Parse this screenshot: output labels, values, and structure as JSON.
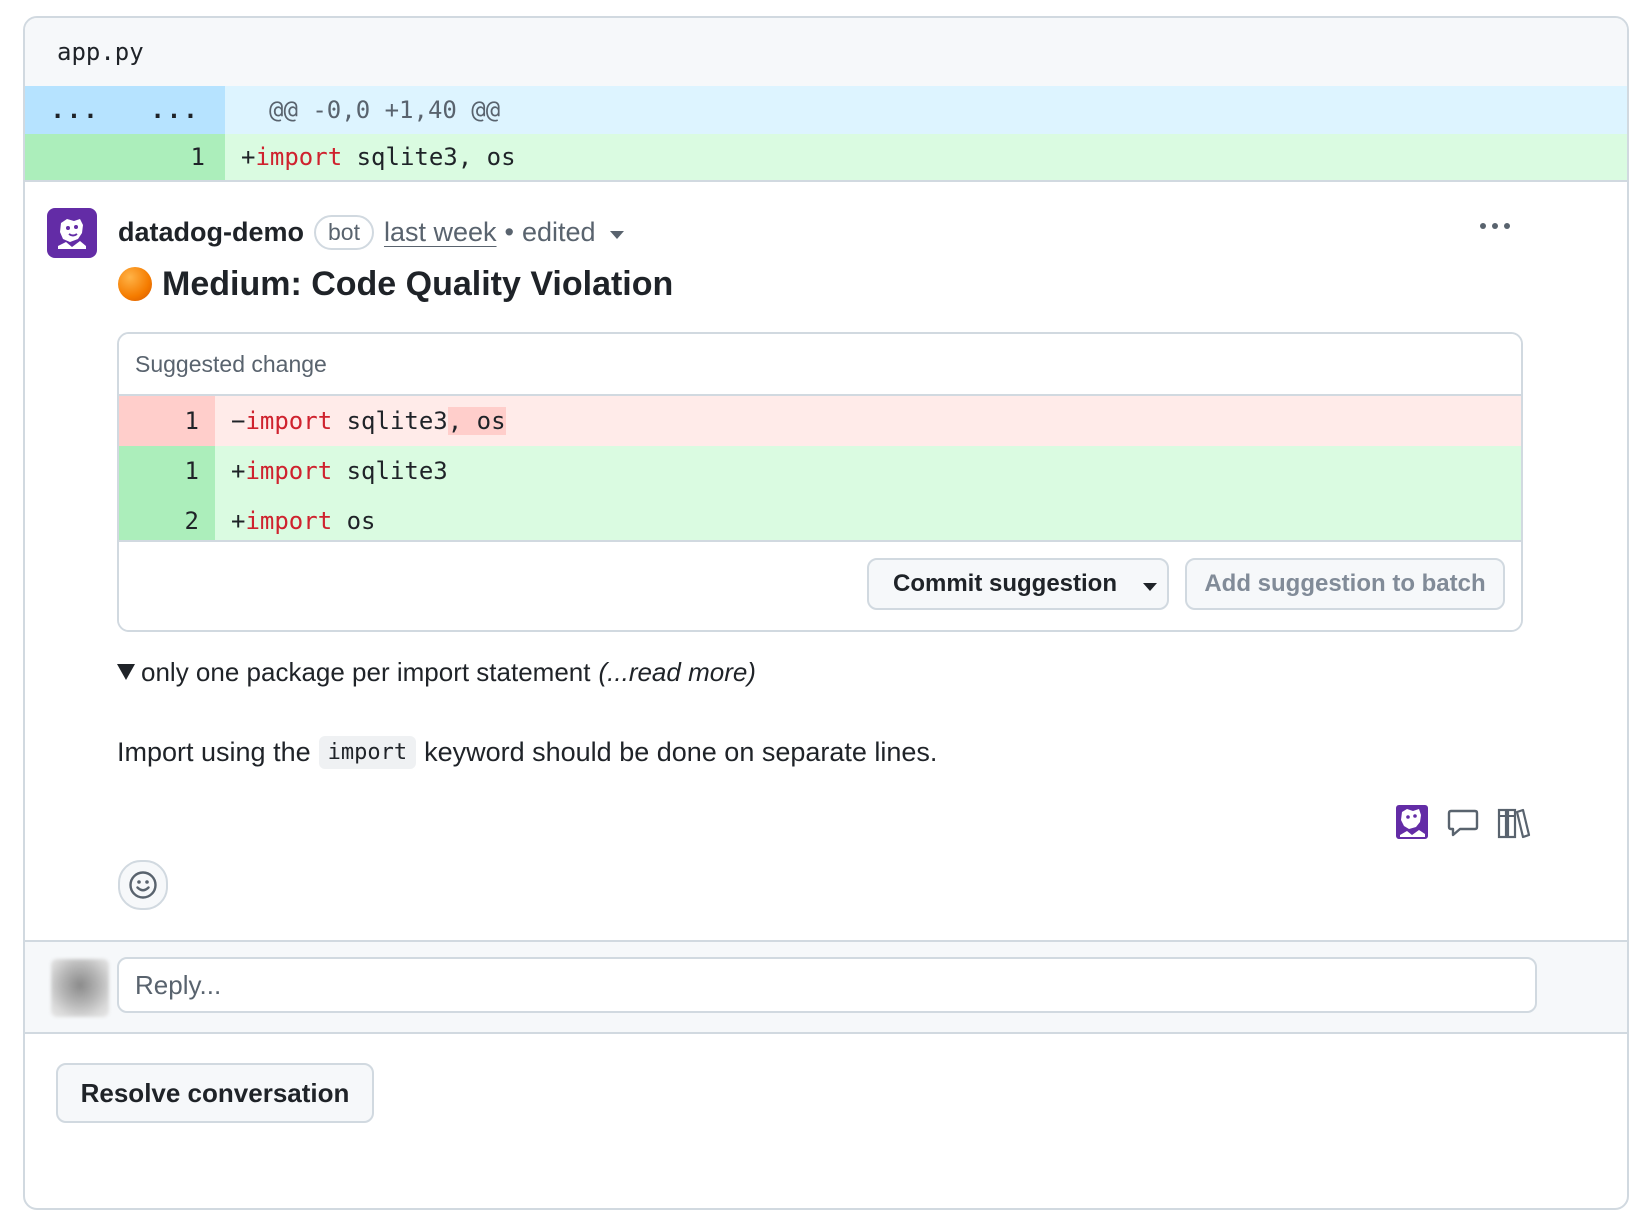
{
  "file": {
    "name": "app.py"
  },
  "hunk": {
    "old_marker": "...",
    "new_marker": "...",
    "header": "@@ -0,0 +1,40 @@"
  },
  "diff_line": {
    "number": "1",
    "sign": "+",
    "keyword": "import",
    "rest": " sqlite3, os"
  },
  "comment": {
    "author": "datadog-demo",
    "badge": "bot",
    "time": "last week",
    "separator": "•",
    "edited": "edited",
    "title": "Medium: Code Quality Violation",
    "severity_color": "#f57c00",
    "icons": [
      "datadog-logo-icon",
      "comment-icon",
      "library-icon",
      "smiley-icon",
      "kebab-menu-icon"
    ]
  },
  "suggestion": {
    "header": "Suggested change",
    "deleted": {
      "number": "1",
      "sign": "−",
      "keyword": "import",
      "kept": " sqlite3",
      "removed": ", os"
    },
    "added": [
      {
        "number": "1",
        "sign": "+",
        "keyword": "import",
        "rest": " sqlite3"
      },
      {
        "number": "2",
        "sign": "+",
        "keyword": "import",
        "rest": " os"
      }
    ],
    "commit_label": "Commit suggestion",
    "batch_label": "Add suggestion to batch"
  },
  "details": {
    "summary": "only one package per import statement",
    "read_more": "(...read more)"
  },
  "description": {
    "before": "Import using the",
    "code": "import",
    "after": "keyword should be done on separate lines."
  },
  "reply": {
    "placeholder": "Reply..."
  },
  "resolve_label": "Resolve conversation",
  "colors": {
    "add_bg": "#dafbe1",
    "add_gutter": "#aceebb",
    "del_bg": "#ffebe9",
    "del_gutter": "#ffcecb",
    "hunk_bg": "#ddf4ff",
    "datadog_purple": "#632ca6",
    "keyword": "#cf222e"
  }
}
